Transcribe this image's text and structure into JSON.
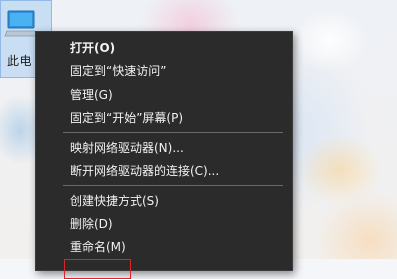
{
  "desktop": {
    "icon_name": "computer-icon",
    "icon_label": "此电"
  },
  "context_menu": {
    "items": [
      {
        "label": "打开(O)",
        "bold": true
      },
      {
        "label": "固定到“快速访问”"
      },
      {
        "label": "管理(G)"
      },
      {
        "label": "固定到“开始”屏幕(P)"
      },
      {
        "label": "映射网络驱动器(N)..."
      },
      {
        "label": "断开网络驱动器的连接(C)..."
      },
      {
        "label": "创建快捷方式(S)"
      },
      {
        "label": "删除(D)"
      },
      {
        "label": "重命名(M)"
      }
    ],
    "highlight_color": "#d9252a"
  }
}
